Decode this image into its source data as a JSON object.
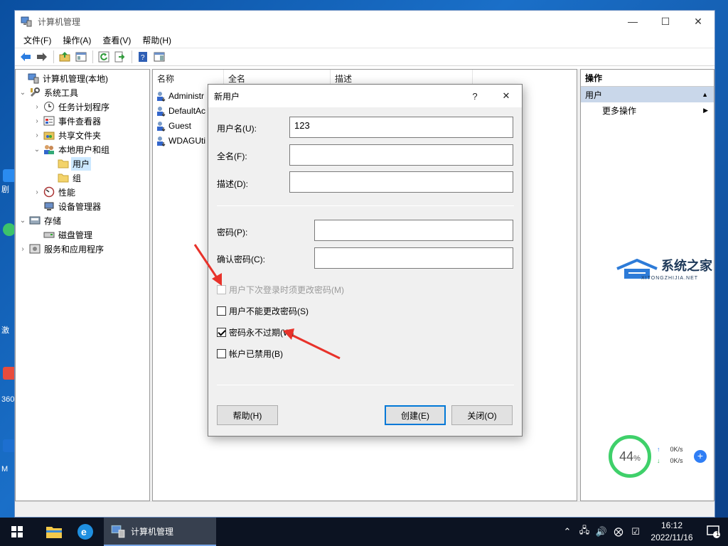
{
  "window": {
    "title": "计算机管理",
    "menu": [
      "文件(F)",
      "操作(A)",
      "查看(V)",
      "帮助(H)"
    ]
  },
  "tree": {
    "nodes": [
      {
        "label": "计算机管理(本地)",
        "level": 0,
        "expander": "",
        "icon": "computer-management-icon"
      },
      {
        "label": "系统工具",
        "level": 1,
        "expander": "⌄",
        "icon": "tools-icon"
      },
      {
        "label": "任务计划程序",
        "level": 2,
        "expander": "›",
        "icon": "clock-icon"
      },
      {
        "label": "事件查看器",
        "level": 2,
        "expander": "›",
        "icon": "event-viewer-icon"
      },
      {
        "label": "共享文件夹",
        "level": 2,
        "expander": "›",
        "icon": "shared-folder-icon"
      },
      {
        "label": "本地用户和组",
        "level": 2,
        "expander": "⌄",
        "icon": "users-group-icon"
      },
      {
        "label": "用户",
        "level": 3,
        "expander": "",
        "icon": "folder-icon",
        "selected": true
      },
      {
        "label": "组",
        "level": 3,
        "expander": "",
        "icon": "folder-icon"
      },
      {
        "label": "性能",
        "level": 2,
        "expander": "›",
        "icon": "performance-icon"
      },
      {
        "label": "设备管理器",
        "level": 2,
        "expander": "",
        "icon": "device-manager-icon"
      },
      {
        "label": "存储",
        "level": 1,
        "expander": "⌄",
        "icon": "storage-icon"
      },
      {
        "label": "磁盘管理",
        "level": 2,
        "expander": "",
        "icon": "disk-icon"
      },
      {
        "label": "服务和应用程序",
        "level": 1,
        "expander": "›",
        "icon": "services-icon"
      }
    ]
  },
  "list": {
    "columns": [
      "名称",
      "全名",
      "描述"
    ],
    "rows": [
      "Administr",
      "DefaultAc",
      "Guest",
      "WDAGUti"
    ]
  },
  "actions": {
    "header": "操作",
    "section": "用户",
    "item": "更多操作"
  },
  "dialog": {
    "title": "新用户",
    "help_glyph": "?",
    "close_glyph": "✕",
    "username_label": "用户名(U):",
    "username_value": "123",
    "fullname_label": "全名(F):",
    "fullname_value": "",
    "description_label": "描述(D):",
    "description_value": "",
    "password_label": "密码(P):",
    "confirm_label": "确认密码(C):",
    "checkboxes": [
      {
        "label": "用户下次登录时须更改密码(M)",
        "checked": false,
        "disabled": true
      },
      {
        "label": "用户不能更改密码(S)",
        "checked": false,
        "disabled": false
      },
      {
        "label": "密码永不过期(W)",
        "checked": true,
        "disabled": false
      },
      {
        "label": "帐户已禁用(B)",
        "checked": false,
        "disabled": false
      }
    ],
    "help_button": "帮助(H)",
    "create_button": "创建(E)",
    "close_button": "关闭(O)"
  },
  "watermark": {
    "name": "系统之家",
    "sub": "XITONGZHIJIA.NET"
  },
  "speed_widget": {
    "percent": "44",
    "percent_sign": "%",
    "up": "0K/s",
    "down": "0K/s",
    "plus": "+"
  },
  "taskbar": {
    "app_label": "计算机管理",
    "time": "16:12",
    "date": "2022/11/16",
    "notification_count": "1"
  },
  "desktop_edge": [
    "剧",
    "激",
    "360",
    "M"
  ],
  "colors": {
    "accent": "#0078d7",
    "selection": "#cce8ff",
    "arrow": "#e8322a"
  }
}
